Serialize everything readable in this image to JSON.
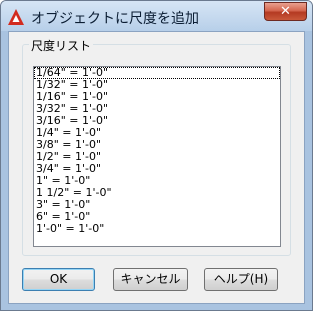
{
  "window": {
    "title": "オブジェクトに尺度を追加",
    "close_label": "✕"
  },
  "group": {
    "label": "尺度リスト"
  },
  "scale_list": {
    "items": [
      "1/64\" = 1'-0\"",
      "1/32\" = 1'-0\"",
      "1/16\" = 1'-0\"",
      "3/32\" = 1'-0\"",
      "3/16\" = 1'-0\"",
      "1/4\" = 1'-0\"",
      "3/8\" = 1'-0\"",
      "1/2\" = 1'-0\"",
      "3/4\" = 1'-0\"",
      "1\" = 1'-0\"",
      "1 1/2\" = 1'-0\"",
      "3\" = 1'-0\"",
      "6\" = 1'-0\"",
      "1'-0\" = 1'-0\""
    ]
  },
  "buttons": {
    "ok": "OK",
    "cancel": "キャンセル",
    "help": "ヘルプ(H)"
  },
  "colors": {
    "app_icon": "#d22b1f",
    "close_button": "#c9583a"
  },
  "icons": {
    "app": "autocad-a-icon",
    "close": "close-icon"
  }
}
